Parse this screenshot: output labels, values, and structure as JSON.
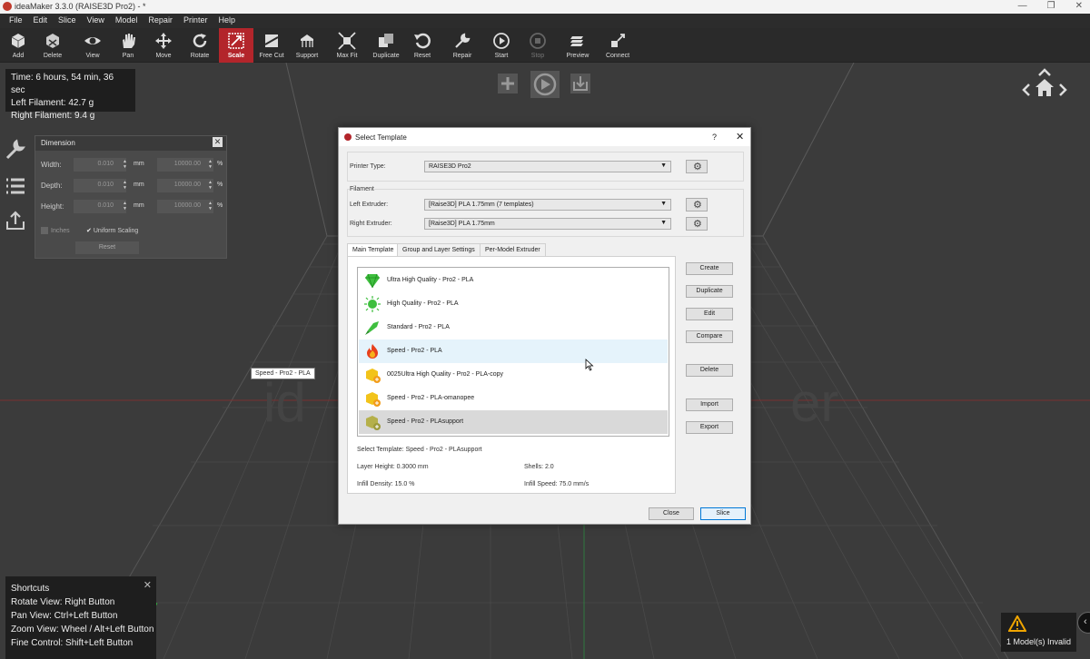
{
  "window": {
    "title": "ideaMaker 3.3.0 (RAISE3D Pro2) - *"
  },
  "menu": [
    "File",
    "Edit",
    "Slice",
    "View",
    "Model",
    "Repair",
    "Printer",
    "Help"
  ],
  "toolbar": [
    {
      "label": "Add",
      "icon": "add-cube-icon"
    },
    {
      "label": "Delete",
      "icon": "delete-cube-icon"
    },
    {
      "label": "View",
      "icon": "eye-icon"
    },
    {
      "label": "Pan",
      "icon": "hand-icon"
    },
    {
      "label": "Move",
      "icon": "move-arrows-icon"
    },
    {
      "label": "Rotate",
      "icon": "rotate-icon"
    },
    {
      "label": "Scale",
      "icon": "scale-icon"
    },
    {
      "label": "Free Cut",
      "icon": "free-cut-icon"
    },
    {
      "label": "Support",
      "icon": "support-icon"
    },
    {
      "label": "Max Fit",
      "icon": "max-fit-icon"
    },
    {
      "label": "Duplicate",
      "icon": "duplicate-icon"
    },
    {
      "label": "Reset",
      "icon": "reset-icon"
    },
    {
      "label": "Repair",
      "icon": "repair-icon"
    },
    {
      "label": "Start",
      "icon": "start-icon"
    },
    {
      "label": "Stop",
      "icon": "stop-icon"
    },
    {
      "label": "Preview",
      "icon": "preview-icon"
    },
    {
      "label": "Connect",
      "icon": "connect-icon"
    }
  ],
  "toolbar_active": "Scale",
  "stats": {
    "time": "Time: 6 hours, 54 min, 36 sec",
    "left": "Left Filament: 42.7 g",
    "right": "Right Filament: 9.4 g"
  },
  "dimension": {
    "title": "Dimension",
    "close": "✕",
    "width_label": "Width:",
    "depth_label": "Depth:",
    "height_label": "Height:",
    "width_mm": "0.010",
    "depth_mm": "0.010",
    "height_mm": "0.010",
    "width_pct": "10000.00",
    "depth_pct": "10000.00",
    "height_pct": "10000.00",
    "unit_mm": "mm",
    "unit_pct": "%",
    "inches": "Inches",
    "uniform": "Uniform Scaling",
    "reset": "Reset"
  },
  "dialog": {
    "title": "Select Template",
    "help": "?",
    "close": "✕",
    "printer_type_label": "Printer Type:",
    "printer_type": "RAISE3D Pro2",
    "filament_label": "Filament",
    "left_extruder_label": "Left Extruder:",
    "left_extruder": "[Raise3D] PLA 1.75mm (7 templates)",
    "right_extruder_label": "Right Extruder:",
    "right_extruder": "[Raise3D] PLA 1.75mm",
    "tabs": [
      "Main Template",
      "Group and Layer Settings",
      "Per-Model Extruder"
    ],
    "templates": [
      {
        "name": "Ultra High Quality - Pro2 - PLA",
        "icon": "diamond-icon"
      },
      {
        "name": "High Quality - Pro2 - PLA",
        "icon": "sun-icon"
      },
      {
        "name": "Standard - Pro2 - PLA",
        "icon": "rocket-icon"
      },
      {
        "name": "Speed - Pro2 - PLA",
        "icon": "flame-icon"
      },
      {
        "name": "0025Ultra High Quality - Pro2 - PLA-copy",
        "icon": "custom-template-icon"
      },
      {
        "name": "Speed - Pro2 - PLA-omanopee",
        "icon": "custom-template-icon"
      },
      {
        "name": "Speed - Pro2 - PLAsupport",
        "icon": "custom-template-icon"
      }
    ],
    "tooltip": "Speed - Pro2 - PLA",
    "selected_info": "Select Template: Speed - Pro2 - PLAsupport",
    "layer_height": "Layer Height: 0.3000 mm",
    "shells": "Shells: 2.0",
    "infill_density": "Infill Density: 15.0 %",
    "infill_speed": "Infill Speed: 75.0 mm/s",
    "actions": [
      "Create",
      "Duplicate",
      "Edit",
      "Compare",
      "Delete",
      "Import",
      "Export"
    ],
    "close_btn": "Close",
    "slice_btn": "Slice"
  },
  "shortcuts": {
    "title": "Shortcuts",
    "close": "✕",
    "rotate": "Rotate View: Right Button",
    "pan": "Pan View: Ctrl+Left Button",
    "zoom": "Zoom View: Wheel / Alt+Left Button",
    "fine": "Fine Control: Shift+Left Button"
  },
  "status": {
    "invalid": "1 Model(s) Invalid"
  },
  "colors": {
    "accent": "#b3252b",
    "hover": "#e5f3fb",
    "selected": "#d9d9d9"
  }
}
